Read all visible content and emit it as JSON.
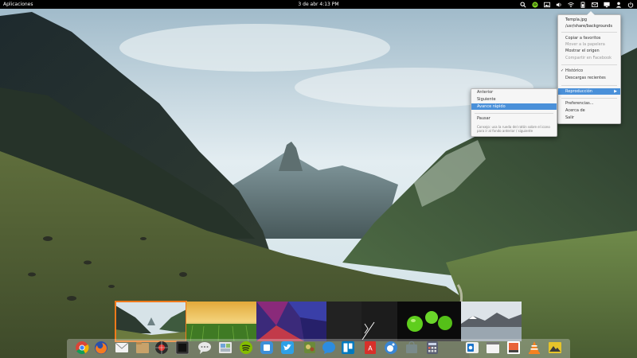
{
  "panel": {
    "apps_label": "Aplicaciones",
    "clock": "3 de abr  4:13 PM",
    "indicators": [
      "search-icon",
      "spotify-icon",
      "image-icon",
      "volume-icon",
      "wifi-icon",
      "battery-icon",
      "mail-icon",
      "monitor-icon",
      "user-icon",
      "power-icon"
    ]
  },
  "wallpaper_menu": {
    "title": "Templa.jpg",
    "path": "/usr/share/backgrounds",
    "items": [
      "Copiar a favoritos",
      "Mover a la papelera",
      "Mostrar el origen",
      "Compartir en Facebook"
    ],
    "history": "Histórico",
    "recent_downloads": "Descargas recientes",
    "playback": "Reproducción",
    "preferences": "Preferencias...",
    "about": "Acerca de",
    "quit": "Salir"
  },
  "playback_menu": {
    "items": [
      "Anterior",
      "Siguiente",
      "Avance rápido",
      "Pausar"
    ],
    "hint": "Consejo: usa la rueda del ratón sobre el icono para ir al fondo anterior / siguiente"
  },
  "colors": {
    "panel_bg": "#000000",
    "menu_highlight": "#4a90d9",
    "thumb_selected": "#f07a1b"
  },
  "thumbnails": [
    {
      "name": "mountain-valley",
      "selected": true
    },
    {
      "name": "green-field-sunset",
      "selected": false
    },
    {
      "name": "purple-polygons",
      "selected": false
    },
    {
      "name": "dark-cursor",
      "selected": false
    },
    {
      "name": "green-apples",
      "selected": false
    },
    {
      "name": "snow-mountain-lake",
      "selected": false
    }
  ],
  "dock_icons": [
    "chrome-icon",
    "firefox-icon",
    "mail-icon",
    "files-icon",
    "screenshot-icon",
    "terminal-icon",
    "chat-icon",
    "photos-icon",
    "spotify-icon",
    "package-icon",
    "twitter-icon",
    "game-icon",
    "messenger-icon",
    "trello-icon",
    "acrobat-icon",
    "gnome-icon",
    "store-icon",
    "calculator-icon",
    "outlook-icon",
    "notes-icon",
    "image-viewer-icon",
    "vlc-icon",
    "wallpaper-icon"
  ]
}
